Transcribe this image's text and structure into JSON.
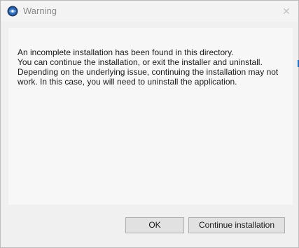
{
  "window": {
    "title": "Warning",
    "close_glyph": "✕",
    "app_icon": "globe-app-icon"
  },
  "message": {
    "lines": [
      "An incomplete installation has been found in this directory.",
      "You can continue the installation, or exit the installer and uninstall.",
      "Depending on the underlying issue, continuing the installation may not",
      "work. In this case, you will need to uninstall the application."
    ]
  },
  "buttons": {
    "ok_label": "OK",
    "continue_label": "Continue installation"
  },
  "colors": {
    "button_face": "#e1e1e1",
    "button_border": "#adadad",
    "icon_blue": "#1f4e8c",
    "accent": "#1f6fd1"
  }
}
